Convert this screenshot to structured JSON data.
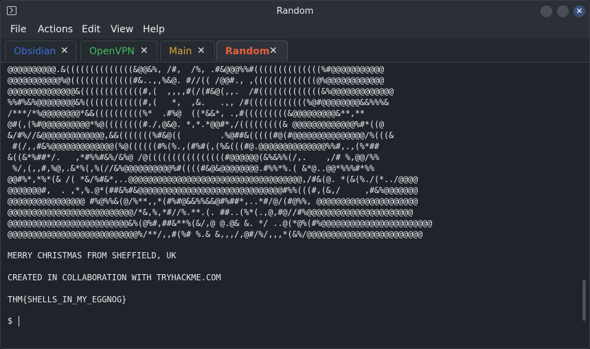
{
  "window": {
    "title": "Random"
  },
  "menu": [
    "File",
    "Actions",
    "Edit",
    "View",
    "Help"
  ],
  "tabs": [
    {
      "label": "Obsidian",
      "color": "#3d6fd8",
      "active": false
    },
    {
      "label": "OpenVPN",
      "color": "#3fbf5f",
      "active": false
    },
    {
      "label": "Main",
      "color": "#e0a53a",
      "active": false
    },
    {
      "label": "Random",
      "color": "#e85f3a",
      "active": true
    }
  ],
  "terminal": {
    "ascii_art": [
      "@@@@@@@@@@.&((((((((((((((&@@&%, /#,  /%, .#&@@@%%#((((((((((((((%#@@@@@@@@@@@",
      "@@@@@@@@@@@%@(((((((((((((#&..,,%&@. #//(( /@@#., ,(((((((((((((@%@@@@@@@@@@@@",
      "@@@@@@@@@@@@@@&(((((((((((((#,(  ,,,,#(/(#&@(,,.  /#(((((((((((((&%@@@@@@@@@@@@@",
      "%%#%&%@@@@@@@@&%((((((((((((#,(   *,  ,&.   .,, /#((((((((((((%@#@@@@@@@@&&%%%&",
      "/***/*%@@@@@@@@*&&((((((((((%*  .#%@  ((*&&*, .,#(((((((((&@@@@@@@@@&**,**",
      "@#(,(%#@@@@@@@@@@*%@((((((((#./,@&@. *,*.*@@#*,/(((((((((& @@@@@@@@@@@@@%#*((@",
      "&/#%//&@@@@@@@@@@@@@,&&(((((((%#&@((        .%@##&(((((#@(#@@@@@@@@@@@@@@@/%(((&",
      " #(/,,#&%@@@@@@@@@@@@@(%@((((((#%(%.,(#%#(,(%&(((#@.@@@@@@@@@@@@@@%%#,.,(%*##",
      "&((&*%##*/.   ,*#%%#&%/&%@ /@((((((((((((((((#@@@@@@(&%&%%(/,.    ,/# %,@@/%%",
      " %/,(,,#,%@,.&*%(,%(//&%@@@@@@@@@@%#((((#&@&@@@@@@@@.#%%*%.( &*@..@@*%%%#*%%",
      "@@#%*,*%*(& /( *&/%#&*,..@@@@@@@@@@@@@@@@@@@@@@@@@@@@@@@@@@@@,/#&(@. *(&(%./(*../@@@@",
      "@@@@@@@#,  . ,*,%.@*(##&%#&@@@@@@@@@@@@@@@@@@@@@@@@@@@@@@#%%(((#,(&,/     ,#&%@@@@@@@",
      "@@@@@@@@@@@@@@@@ #%@%%&(@/%**,,*(#%#@&&%%&&@#%##*,..*#/@/(#@%%, @@@@@@@@@@@@@@@@@@@@@",
      "@@@@@@@@@@@@@@@@@@@@@@@@@@/*&,%,*#//%.**.(. ##..(%*(.,@,#@//#%@@@@@@@@@@@@@@@@@@@@@@",
      "@@@@@@@@@@@@@@@@@@@@@@@@@&%(@%#,##&**%(&/,@ @.@& &. */ ..@(*@%(#%@@@@@@@@@@@@@@@@@@@@@@@",
      "@@@@@@@@@@@@@@@@@@@@@@@@@@@%/**/,,#(%# %.& &,,,/,@#/%/,,,*(&%/@@@@@@@@@@@@@@@@@@@@@@@@"
    ],
    "line_merry": "MERRY CHRISTMAS FROM SHEFFIELD, UK",
    "line_created": "CREATED IN COLLABORATION WITH TRYHACKME.COM",
    "line_flag": "THM{SHELLS_IN_MY_EGGNOG}",
    "prompt": "$"
  }
}
